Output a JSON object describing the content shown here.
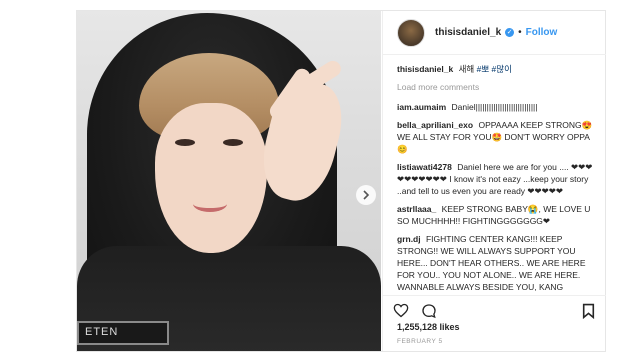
{
  "post": {
    "username": "thisisdaniel_k",
    "follow_label": "Follow",
    "dot": "•",
    "caption": {
      "user": "thisisdaniel_k",
      "text": "새해",
      "tags": "#뽀 #많이"
    },
    "load_more": "Load more comments",
    "comments": [
      {
        "user": "iam.aumaim",
        "text": "Daniel||||||||||||||||||||||||||||"
      },
      {
        "user": "bella_apriliani_exo",
        "text": "OPPAAAA KEEP STRONG😍 WE ALL STAY FOR YOU🤩 DON'T WORRY OPPA😊"
      },
      {
        "user": "listiawati4278",
        "text": "Daniel here we are for you .... ❤❤❤❤❤❤❤❤❤❤ I know it's not eazy ...keep your story ..and tell to us even you are ready ❤❤❤❤❤"
      },
      {
        "user": "astrllaaa_",
        "text": "KEEP STRONG BABY😭, WE LOVE U SO MUCHHHH!! FIGHTINGGGGGGG❤"
      },
      {
        "user": "grn.dj",
        "text": "FIGHTING CENTER KANG!!! KEEP STRONG!! WE WILL ALWAYS SUPPORT YOU HERE... DON'T HEAR OTHERS.. WE ARE HERE FOR YOU.. YOU NOT ALONE.. WE ARE HERE. WANNABLE ALWAYS BESIDE YOU, KANG DANIEL. PLEASE.. DON'T WORRY"
      }
    ],
    "likes": "1,255,128 likes",
    "date": "FEBRUARY 5",
    "photo_patch_text": "ETEN",
    "icons": {
      "like": "heart-icon",
      "comment": "comment-icon",
      "save": "bookmark-icon",
      "verified": "verified-badge-icon",
      "next": "chevron-right-icon"
    }
  }
}
